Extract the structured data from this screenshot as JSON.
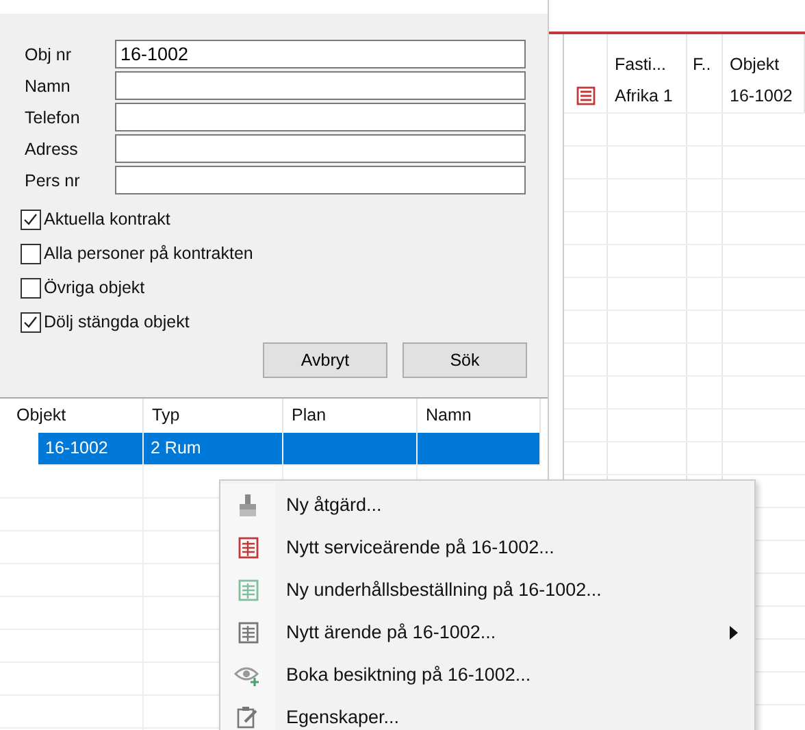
{
  "search_form": {
    "fields": [
      {
        "label": "Obj nr",
        "value": "16-1002"
      },
      {
        "label": "Namn"
      },
      {
        "label": "Telefon"
      },
      {
        "label": "Adress"
      },
      {
        "label": "Pers nr"
      }
    ],
    "options": [
      {
        "label": "Aktuella kontrakt",
        "checked": true
      },
      {
        "label": "Alla personer på kontrakten",
        "checked": false
      },
      {
        "label": "Övriga objekt",
        "checked": false
      },
      {
        "label": "Dölj stängda objekt",
        "checked": true
      }
    ],
    "buttons": [
      "Avbryt",
      "Sök"
    ]
  },
  "object_table": {
    "columns": [
      "Objekt",
      "Typ",
      "Plan",
      "Namn"
    ],
    "rows": [
      {
        "cells": [
          "16-1002",
          "2 Rum"
        ],
        "selected": true
      }
    ]
  },
  "case_table": {
    "columns": [
      "Fasti...",
      "F..",
      "Objekt"
    ],
    "rows": [
      {
        "cells": [
          "Afrika 1",
          "",
          "16-1002"
        ]
      }
    ]
  },
  "context_menu": [
    {
      "label": "Ny åtgärd...",
      "kind": "brush",
      "submenu": false
    },
    {
      "label": "Nytt serviceärende på 16-1002...",
      "kind": "service",
      "submenu": false
    },
    {
      "label": "Ny underhållsbeställning på 16-1002...",
      "kind": "maintenance",
      "submenu": false
    },
    {
      "label": "Nytt ärende på 16-1002...",
      "kind": "case",
      "submenu": true
    },
    {
      "label": "Boka besiktning på 16-1002...",
      "kind": "inspection",
      "submenu": false
    },
    {
      "label": "Egenskaper...",
      "kind": "properties",
      "submenu": false
    }
  ]
}
